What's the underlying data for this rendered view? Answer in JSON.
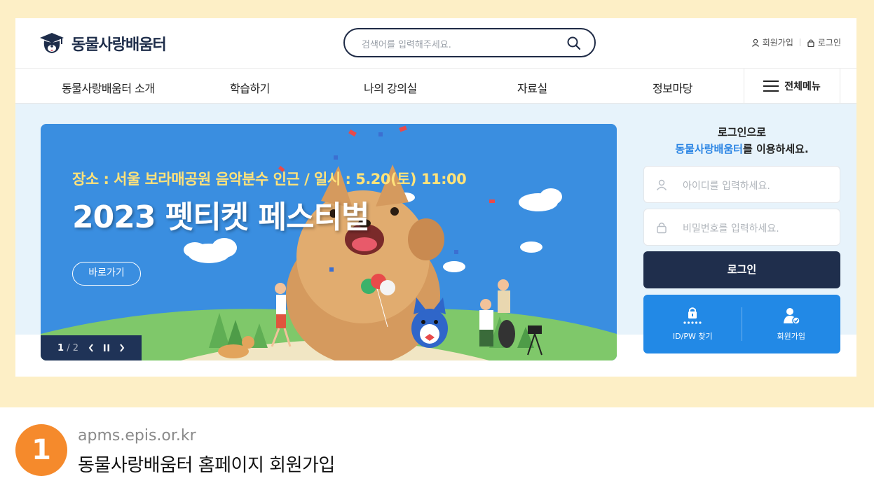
{
  "header": {
    "logo_text": "동물사랑배움터",
    "search_placeholder": "검색어를 입력해주세요.",
    "signup_label": "회원가입",
    "login_label": "로그인"
  },
  "nav": {
    "items": [
      "동물사랑배움터 소개",
      "학습하기",
      "나의 강의실",
      "자료실",
      "정보마당"
    ],
    "all_menu_label": "전체메뉴"
  },
  "banner": {
    "subtitle": "장소 : 서울 보라매공원 음악분수 인근 / 일시 : 5.20(토) 11:00",
    "title": "2023 펫티켓 페스티벌",
    "button_label": "바로가기",
    "pager_current": "1",
    "pager_total": "/ 2"
  },
  "login_box": {
    "heading_line1": "로그인으로",
    "heading_brand": "동물사랑배움터",
    "heading_rest": "를 이용하세요.",
    "id_placeholder": "아이디를 입력하세요.",
    "pw_placeholder": "비밀번호를 입력하세요.",
    "login_button": "로그인",
    "find_label": "ID/PW 찾기",
    "join_label": "회원가입"
  },
  "caption": {
    "number": "1",
    "url": "apms.epis.or.kr",
    "title": "동물사랑배움터 홈페이지 회원가입"
  },
  "colors": {
    "frame_bg": "#fdefc6",
    "navy": "#1f2e4c",
    "accent_blue": "#2289e6",
    "badge_orange": "#f58a2c"
  }
}
